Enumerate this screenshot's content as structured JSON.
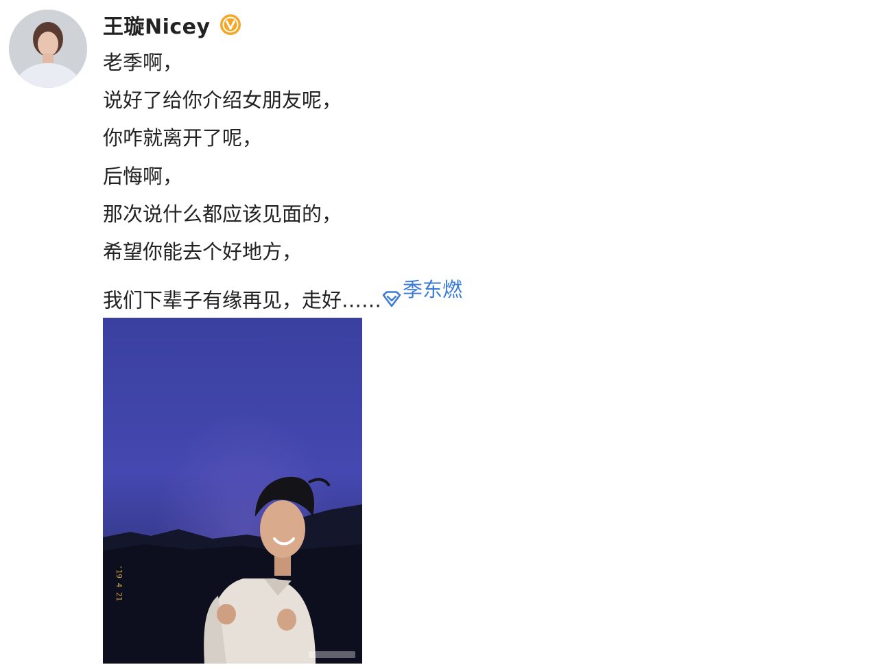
{
  "post": {
    "username": "王璇Nicey",
    "badge_icon": "verified-v-icon",
    "lines": [
      "老季啊，",
      "说好了给你介绍女朋友呢，",
      "你咋就离开了呢，",
      "后悔啊，",
      "那次说什么都应该见面的，",
      "希望你能去个好地方，"
    ],
    "last_line": "我们下辈子有缘再见，走好……",
    "mention": "季东燃",
    "mention_icon": "super-topic-diamond-icon",
    "colors": {
      "badge": "#f5a623",
      "mention": "#3a7bd5",
      "text": "#222222"
    }
  }
}
